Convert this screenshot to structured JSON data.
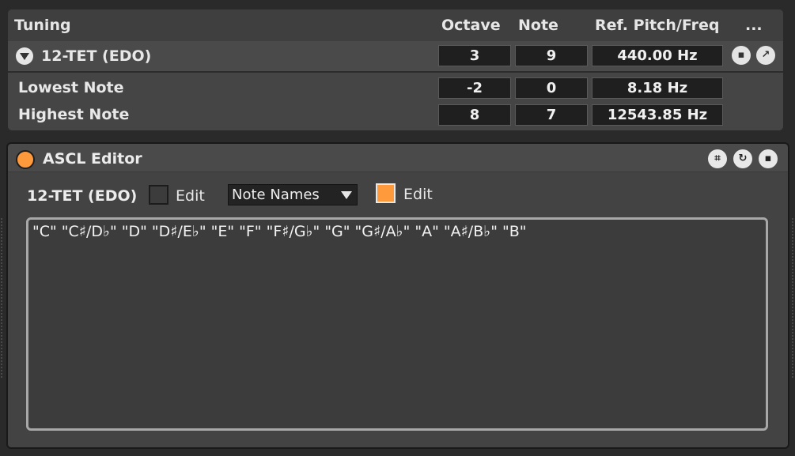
{
  "tuning": {
    "header": {
      "title": "Tuning",
      "octave": "Octave",
      "note": "Note",
      "ref": "Ref. Pitch/Freq",
      "more": "..."
    },
    "current": {
      "name": "12-TET (EDO)",
      "octave": "3",
      "note": "9",
      "freq": "440.00 Hz"
    },
    "lowest": {
      "label": "Lowest Note",
      "octave": "-2",
      "note": "0",
      "freq": "8.18 Hz"
    },
    "highest": {
      "label": "Highest Note",
      "octave": "8",
      "note": "7",
      "freq": "12543.85 Hz"
    }
  },
  "ascl": {
    "title": "ASCL Editor",
    "tuning_name": "12-TET (EDO)",
    "edit1": "Edit",
    "dropdown_value": "Note Names",
    "edit2": "Edit",
    "text": "\"C\" \"C♯/D♭\" \"D\" \"D♯/E♭\" \"E\" \"F\" \"F♯/G♭\" \"G\" \"G♯/A♭\" \"A\" \"A♯/B♭\" \"B\"",
    "accent_color": "#ff9a3c"
  }
}
